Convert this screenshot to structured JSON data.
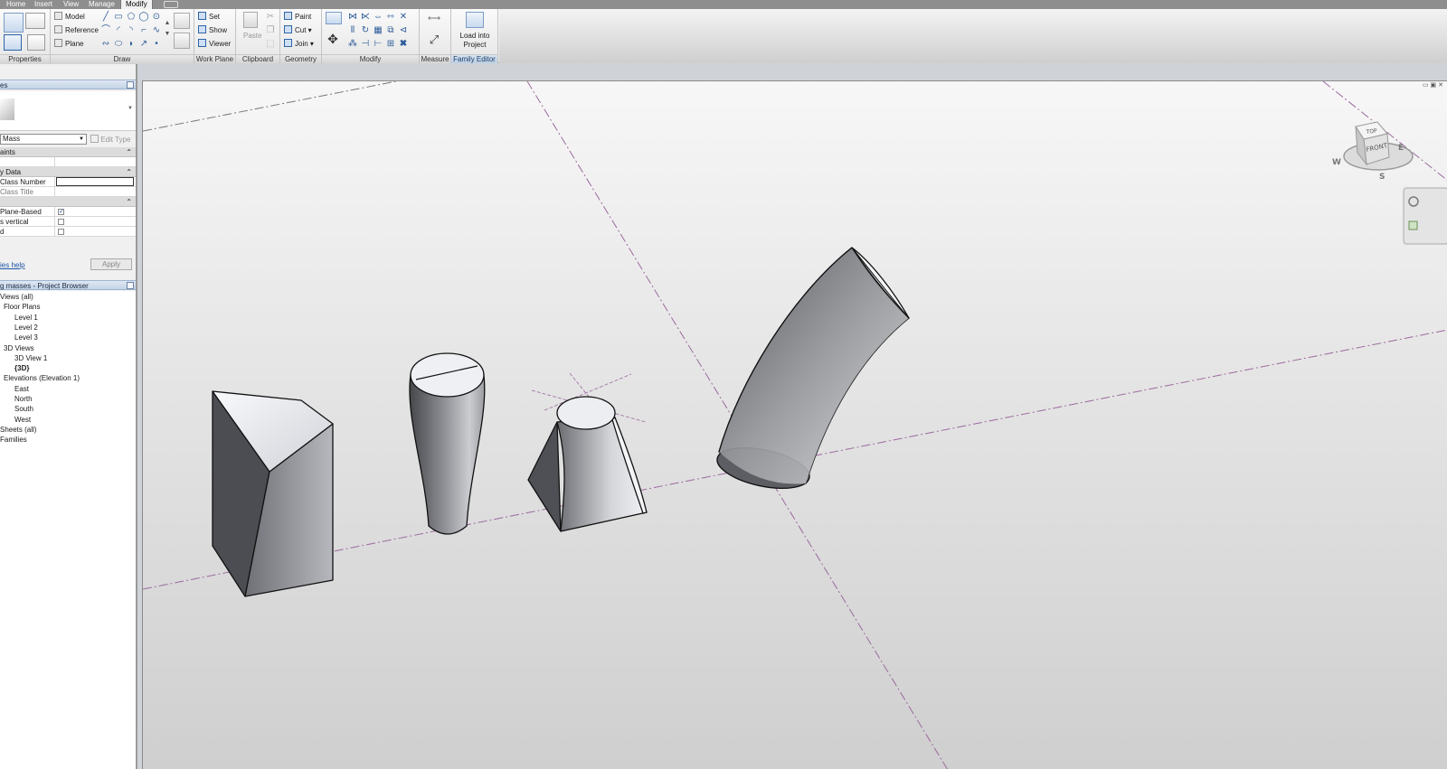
{
  "tabs": [
    {
      "label": "Home"
    },
    {
      "label": "Insert"
    },
    {
      "label": "View"
    },
    {
      "label": "Manage"
    },
    {
      "label": "Modify"
    }
  ],
  "ribbon": {
    "properties": {
      "title": "Properties"
    },
    "draw": {
      "title": "Draw",
      "model": "Model",
      "reference": "Reference",
      "plane": "Plane"
    },
    "work_plane": {
      "title": "Work Plane",
      "set": "Set",
      "show": "Show",
      "viewer": "Viewer"
    },
    "clipboard": {
      "title": "Clipboard",
      "paste": "Paste"
    },
    "geometry": {
      "title": "Geometry",
      "paint": "Paint",
      "cut": "Cut",
      "join": "Join"
    },
    "modify": {
      "title": "Modify"
    },
    "measure": {
      "title": "Measure"
    },
    "family_editor": {
      "title": "Family Editor",
      "load_line1": "Load into",
      "load_line2": "Project"
    }
  },
  "properties_pane": {
    "header": "es",
    "type_selector": "Mass",
    "edit_type": "Edit Type",
    "groups": {
      "constraints": "aints",
      "identity": "y Data",
      "other": ""
    },
    "rows": {
      "class_number": "Class Number",
      "class_title": "Class Title",
      "plane_based": "Plane-Based",
      "vertical": "s vertical",
      "shared": "d"
    },
    "plane_based_checked": true,
    "help_link": "ies help",
    "apply": "Apply"
  },
  "browser": {
    "header": "g masses - Project Browser",
    "items": [
      {
        "label": "Views (all)",
        "indent": 0
      },
      {
        "label": "Floor Plans",
        "indent": 1
      },
      {
        "label": "Level 1",
        "indent": 2
      },
      {
        "label": "Level 2",
        "indent": 2
      },
      {
        "label": "Level 3",
        "indent": 2
      },
      {
        "label": "3D Views",
        "indent": 1
      },
      {
        "label": "3D View 1",
        "indent": 2
      },
      {
        "label": "{3D}",
        "indent": 2,
        "bold": true
      },
      {
        "label": "Elevations (Elevation 1)",
        "indent": 1
      },
      {
        "label": "East",
        "indent": 2
      },
      {
        "label": "North",
        "indent": 2
      },
      {
        "label": "South",
        "indent": 2
      },
      {
        "label": "West",
        "indent": 2
      },
      {
        "label": "Sheets (all)",
        "indent": 0
      },
      {
        "label": "Families",
        "indent": 0
      }
    ]
  },
  "viewcube": {
    "top": "TOP",
    "front": "FRONT",
    "west": "W",
    "east": "E",
    "south": "S"
  },
  "colors": {
    "mass_dark": "#4a4c50",
    "mass_light": "#eceef2",
    "ref_line": "#9b6a9e"
  }
}
